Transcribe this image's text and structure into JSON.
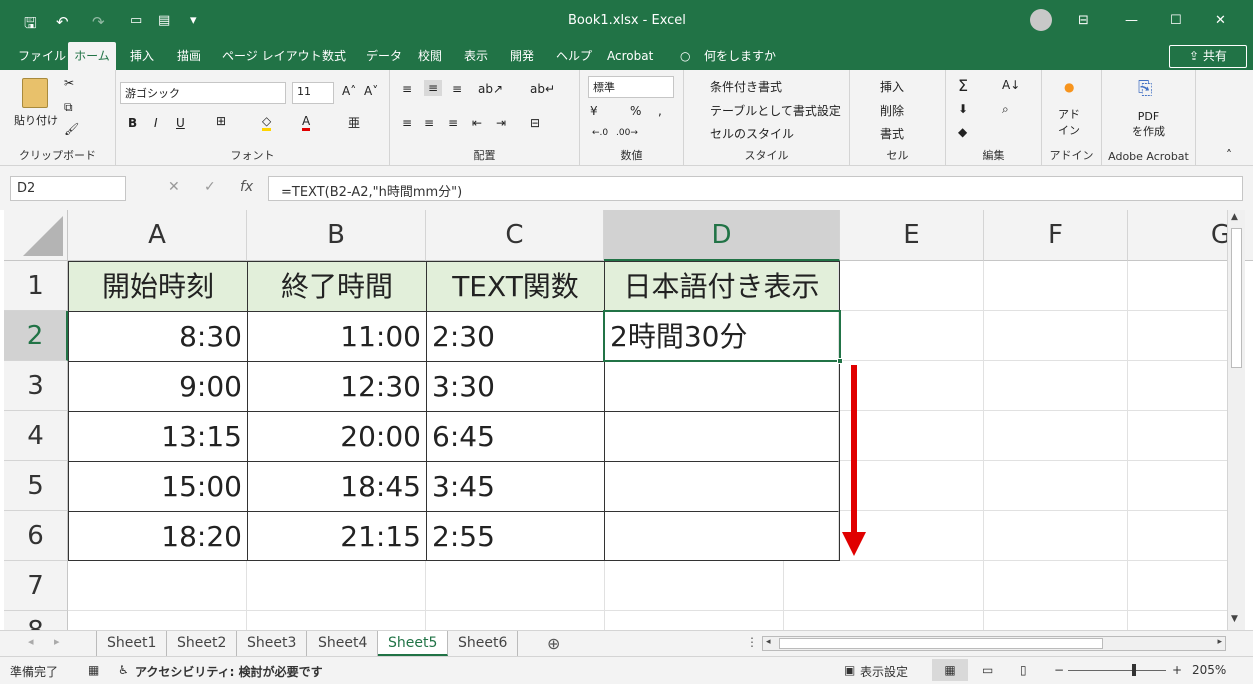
{
  "window": {
    "title": "Book1.xlsx  -  Excel",
    "quick_access": [
      "save-icon",
      "undo-icon",
      "redo-icon",
      "new-icon",
      "form-icon",
      "customize-icon"
    ]
  },
  "menu": {
    "tabs": [
      "ファイル",
      "ホーム",
      "挿入",
      "描画",
      "ページ レイアウト",
      "数式",
      "データ",
      "校閲",
      "表示",
      "開発",
      "ヘルプ",
      "Acrobat"
    ],
    "active": "ホーム",
    "search": "何をしますか",
    "share": "共有"
  },
  "ribbon": {
    "clipboard": {
      "paste": "貼り付け",
      "label": "クリップボード"
    },
    "font": {
      "name": "游ゴシック",
      "size": "11",
      "bold": "B",
      "italic": "I",
      "underline": "U",
      "label": "フォント"
    },
    "alignment": {
      "label": "配置"
    },
    "number": {
      "format": "標準",
      "percent": "%",
      "comma": ",",
      "label": "数値"
    },
    "styles": {
      "conditional": "条件付き書式",
      "table": "テーブルとして書式設定",
      "cell_styles": "セルのスタイル",
      "label": "スタイル"
    },
    "cells": {
      "insert": "挿入",
      "delete": "削除",
      "format": "書式",
      "label": "セル"
    },
    "editing": {
      "label": "編集"
    },
    "addin": {
      "text": "アド\nイン",
      "label": "アドイン"
    },
    "acrobat": {
      "text": "PDF\nを作成",
      "label": "Adobe Acrobat"
    }
  },
  "formula_bar": {
    "name_box": "D2",
    "formula": "=TEXT(B2-A2,\"h時間mm分\")",
    "fx": "fx"
  },
  "grid": {
    "columns": [
      "A",
      "B",
      "C",
      "D",
      "E",
      "F",
      "G"
    ],
    "rows": [
      "1",
      "2",
      "3",
      "4",
      "5",
      "6",
      "7",
      "8"
    ],
    "headers": [
      "開始時刻",
      "終了時間",
      "TEXT関数",
      "日本語付き表示"
    ],
    "data": [
      [
        "8:30",
        "11:00",
        "2:30",
        "2時間30分"
      ],
      [
        "9:00",
        "12:30",
        "3:30",
        ""
      ],
      [
        "13:15",
        "20:00",
        "6:45",
        ""
      ],
      [
        "15:00",
        "18:45",
        "3:45",
        ""
      ],
      [
        "18:20",
        "21:15",
        "2:55",
        ""
      ]
    ],
    "selected_cell": "D2"
  },
  "sheets": {
    "tabs": [
      "Sheet1",
      "Sheet2",
      "Sheet3",
      "Sheet4",
      "Sheet5",
      "Sheet6"
    ],
    "active": "Sheet5"
  },
  "status": {
    "ready": "準備完了",
    "accessibility": "アクセシビリティ: 検討が必要です",
    "display_settings": "表示設定",
    "zoom": "205%"
  },
  "colors": {
    "excel_green": "#217346",
    "header_fill": "#e2efda",
    "arrow": "#e00000"
  }
}
